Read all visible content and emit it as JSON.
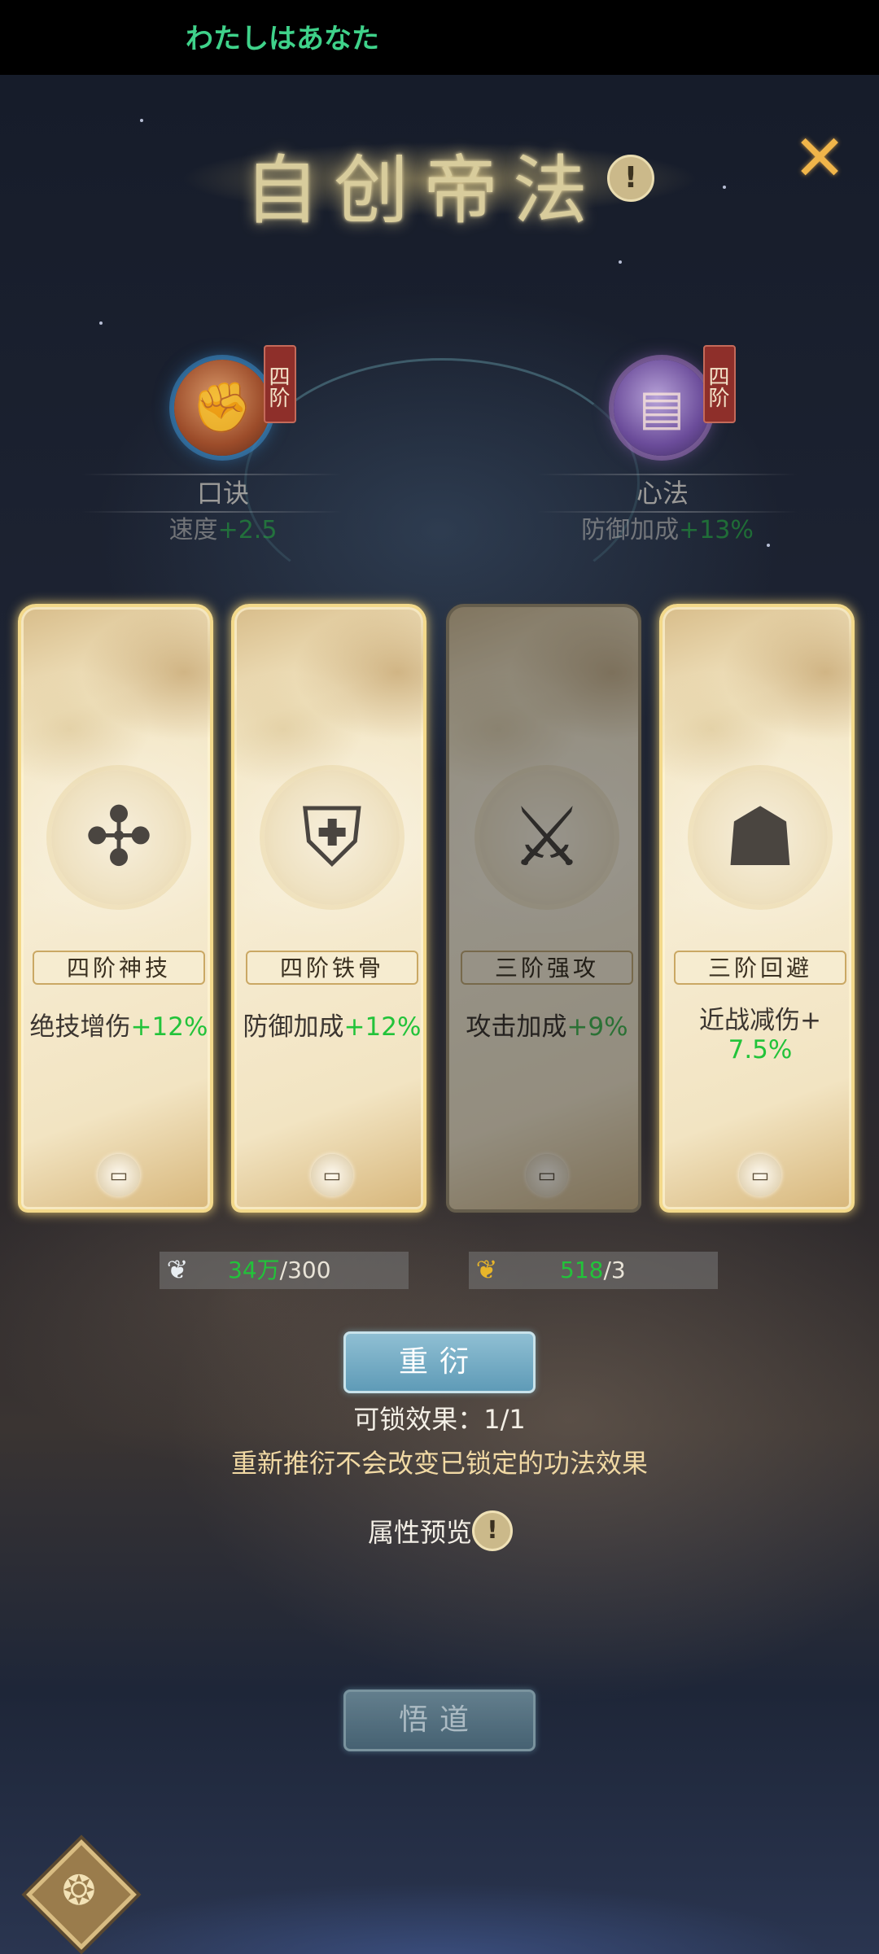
{
  "marquee": "わたしはあなた",
  "title": "自创帝法",
  "title_info_icon": "info-icon",
  "close_icon": "✕",
  "slots": [
    {
      "name": "口诀",
      "tier": "四阶",
      "attr_label": "速度",
      "attr_value": "+2.5",
      "icon": "flame-fist-icon"
    },
    {
      "name": "心法",
      "tier": "四阶",
      "attr_label": "防御加成",
      "attr_value": "+13%",
      "icon": "scroll-book-icon"
    }
  ],
  "cards": [
    {
      "badge": "四阶神技",
      "effect_label": "绝技增伤",
      "effect_value": "+12%",
      "icon": "spiral-arrows-icon",
      "locked": false
    },
    {
      "badge": "四阶铁骨",
      "effect_label": "防御加成",
      "effect_value": "+12%",
      "icon": "shield-plus-icon",
      "locked": false
    },
    {
      "badge": "三阶强攻",
      "effect_label": "攻击加成",
      "effect_value": "+9%",
      "icon": "sword-plus-icon",
      "locked": true
    },
    {
      "badge": "三阶回避",
      "effect_label": "近战减伤+",
      "effect_value": "7.5%",
      "icon": "warrior-circle-icon",
      "locked": false
    }
  ],
  "resources": [
    {
      "icon": "silver-leaf-icon",
      "have": "34万",
      "need": "/300"
    },
    {
      "icon": "gold-leaf-icon",
      "have": "518",
      "need": "/3"
    }
  ],
  "reroll_button": "重衍",
  "lockable_text": "可锁效果：1/1",
  "hint_text": "重新推衍不会改变已锁定的功法效果",
  "preview_label": "属性预览",
  "enlighten_button": "悟道",
  "colors": {
    "accent_green": "#22c33a",
    "card_border": "#f3d98a",
    "button_blue": "#5f9bb7",
    "tier_red": "#8e2f2a"
  }
}
